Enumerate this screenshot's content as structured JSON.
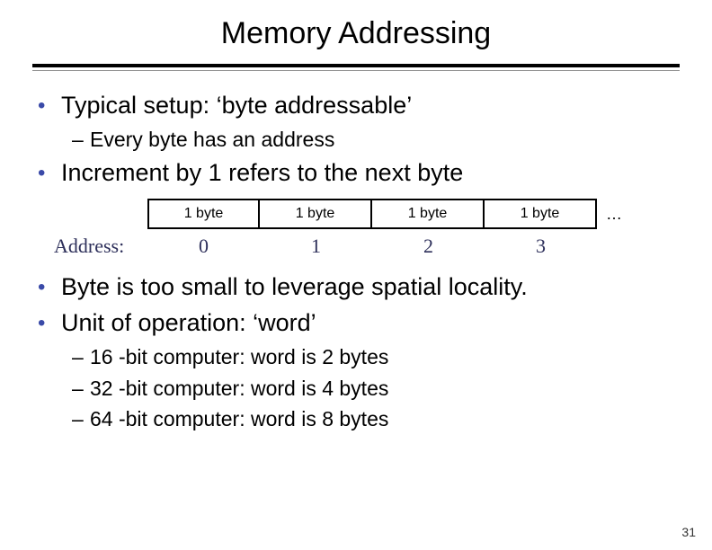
{
  "title": "Memory Addressing",
  "bullet1": "Typical setup: ‘byte addressable’",
  "bullet1_sub1": "Every byte has an address",
  "bullet2": "Increment by 1 refers to the next byte",
  "diagram": {
    "cell0": "1 byte",
    "cell1": "1 byte",
    "cell2": "1 byte",
    "cell3": "1 byte",
    "dots": "…"
  },
  "address": {
    "label": "Address:",
    "n0": "0",
    "n1": "1",
    "n2": "2",
    "n3": "3"
  },
  "bullet3": "Byte is too small to leverage spatial locality.",
  "bullet4": "Unit of operation: ‘word’",
  "bullet4_sub1": "16 -bit computer: word is 2 bytes",
  "bullet4_sub2": "32 -bit computer: word is 4 bytes",
  "bullet4_sub3": "64 -bit computer: word is 8 bytes",
  "page_number": "31"
}
